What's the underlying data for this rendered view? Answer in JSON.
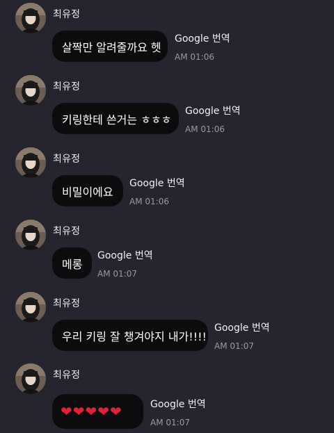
{
  "messages": [
    {
      "sender": "최유정",
      "text": "살짝만 알려줄까요 헷",
      "translate_label": "Google 번역",
      "time": "AM 01:06"
    },
    {
      "sender": "최유정",
      "text": "키링한테 쓴거는 ㅎㅎㅎ",
      "translate_label": "Google 번역",
      "time": "AM 01:06"
    },
    {
      "sender": "최유정",
      "text": "비밀이에요",
      "translate_label": "Google 번역",
      "time": "AM 01:06"
    },
    {
      "sender": "최유정",
      "text": "메롱",
      "translate_label": "Google 번역",
      "time": "AM 01:07"
    },
    {
      "sender": "최유정",
      "text": "우리 키링 잘 챙겨야지 내가!!!!",
      "translate_label": "Google 번역",
      "time": "AM 01:07"
    },
    {
      "sender": "최유정",
      "text": "❤❤❤❤❤",
      "translate_label": "Google 번역",
      "time": "AM 01:07"
    }
  ],
  "colors": {
    "background": "#26252f",
    "bubble": "#0c0c0f",
    "heart": "#e0213a",
    "timestamp": "#9a99a4"
  },
  "icons": [
    "avatar-photo"
  ]
}
